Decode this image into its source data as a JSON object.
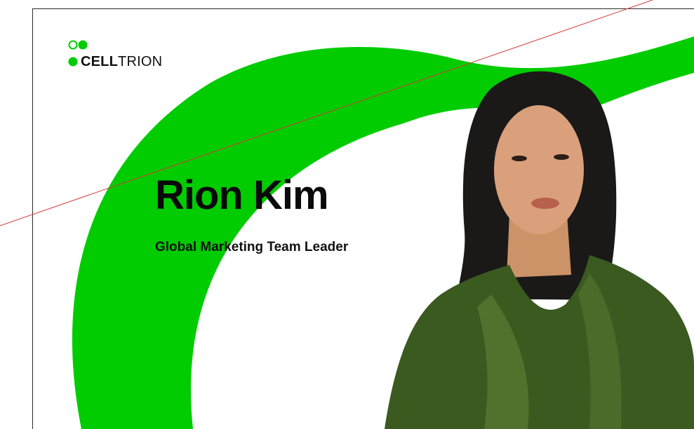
{
  "brand": {
    "logo_bold": "CELL",
    "logo_light": "TRION"
  },
  "profile": {
    "name": "Rion Kim",
    "title": "Global Marketing Team Leader"
  },
  "colors": {
    "accent_green": "#00cc00",
    "blazer_green": "#3a5a20",
    "hair": "#1b1818",
    "skin": "#d9a07b",
    "guide_line": "#d63b3b",
    "text": "#111111",
    "background": "#ffffff"
  },
  "icons": {
    "logo": "celltrion-three-dots-logo"
  }
}
